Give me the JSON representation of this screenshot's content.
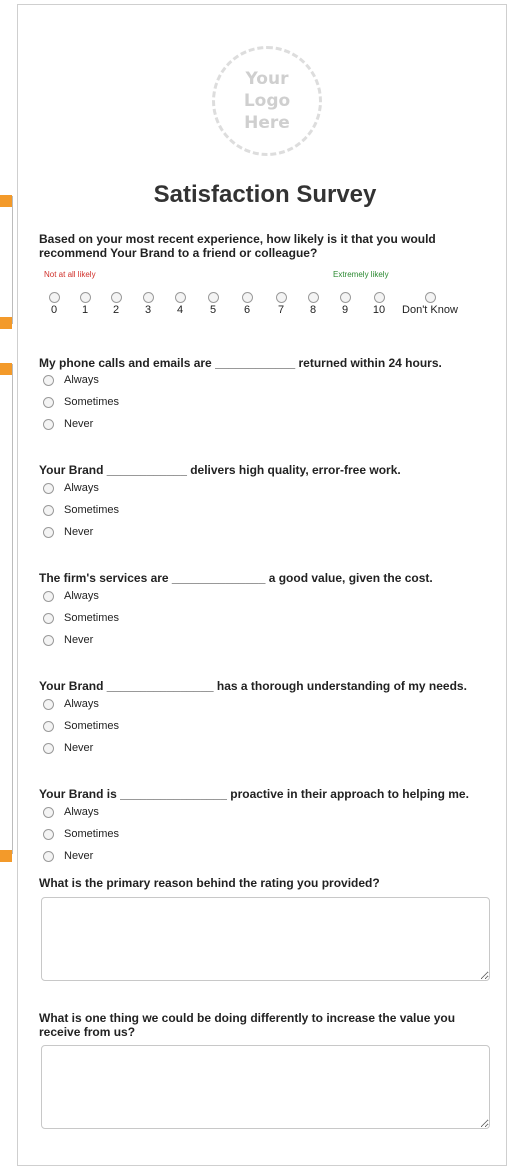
{
  "logo": {
    "text": "Your\nLogo\nHere"
  },
  "title": "Satisfaction Survey",
  "nps": {
    "question": "Based on your most recent experience, how likely is it that you would recommend Your Brand to a friend or colleague?",
    "low_label": "Not at all likely",
    "high_label": "Extremely likely",
    "low_color": "#d0302a",
    "high_color": "#2c8a32",
    "options": [
      "0",
      "1",
      "2",
      "3",
      "4",
      "5",
      "6",
      "7",
      "8",
      "9",
      "10",
      "Don't Know"
    ]
  },
  "choice_options": [
    "Always",
    "Sometimes",
    "Never"
  ],
  "questions": [
    {
      "text": "My phone calls and emails are ____________ returned within 24 hours."
    },
    {
      "text": "Your Brand ____________ delivers high quality, error-free work."
    },
    {
      "text": "The firm's services are ______________ a good value, given the cost."
    },
    {
      "text": "Your Brand ________________ has a thorough understanding of my needs."
    },
    {
      "text": "Your Brand is ________________ proactive in their approach to helping me."
    }
  ],
  "open_questions": [
    {
      "text": "What is the primary reason behind the rating you provided?"
    },
    {
      "text": "What is one thing we could be doing differently to increase the value you receive from us?"
    }
  ],
  "accent_color": "#f39a2a"
}
